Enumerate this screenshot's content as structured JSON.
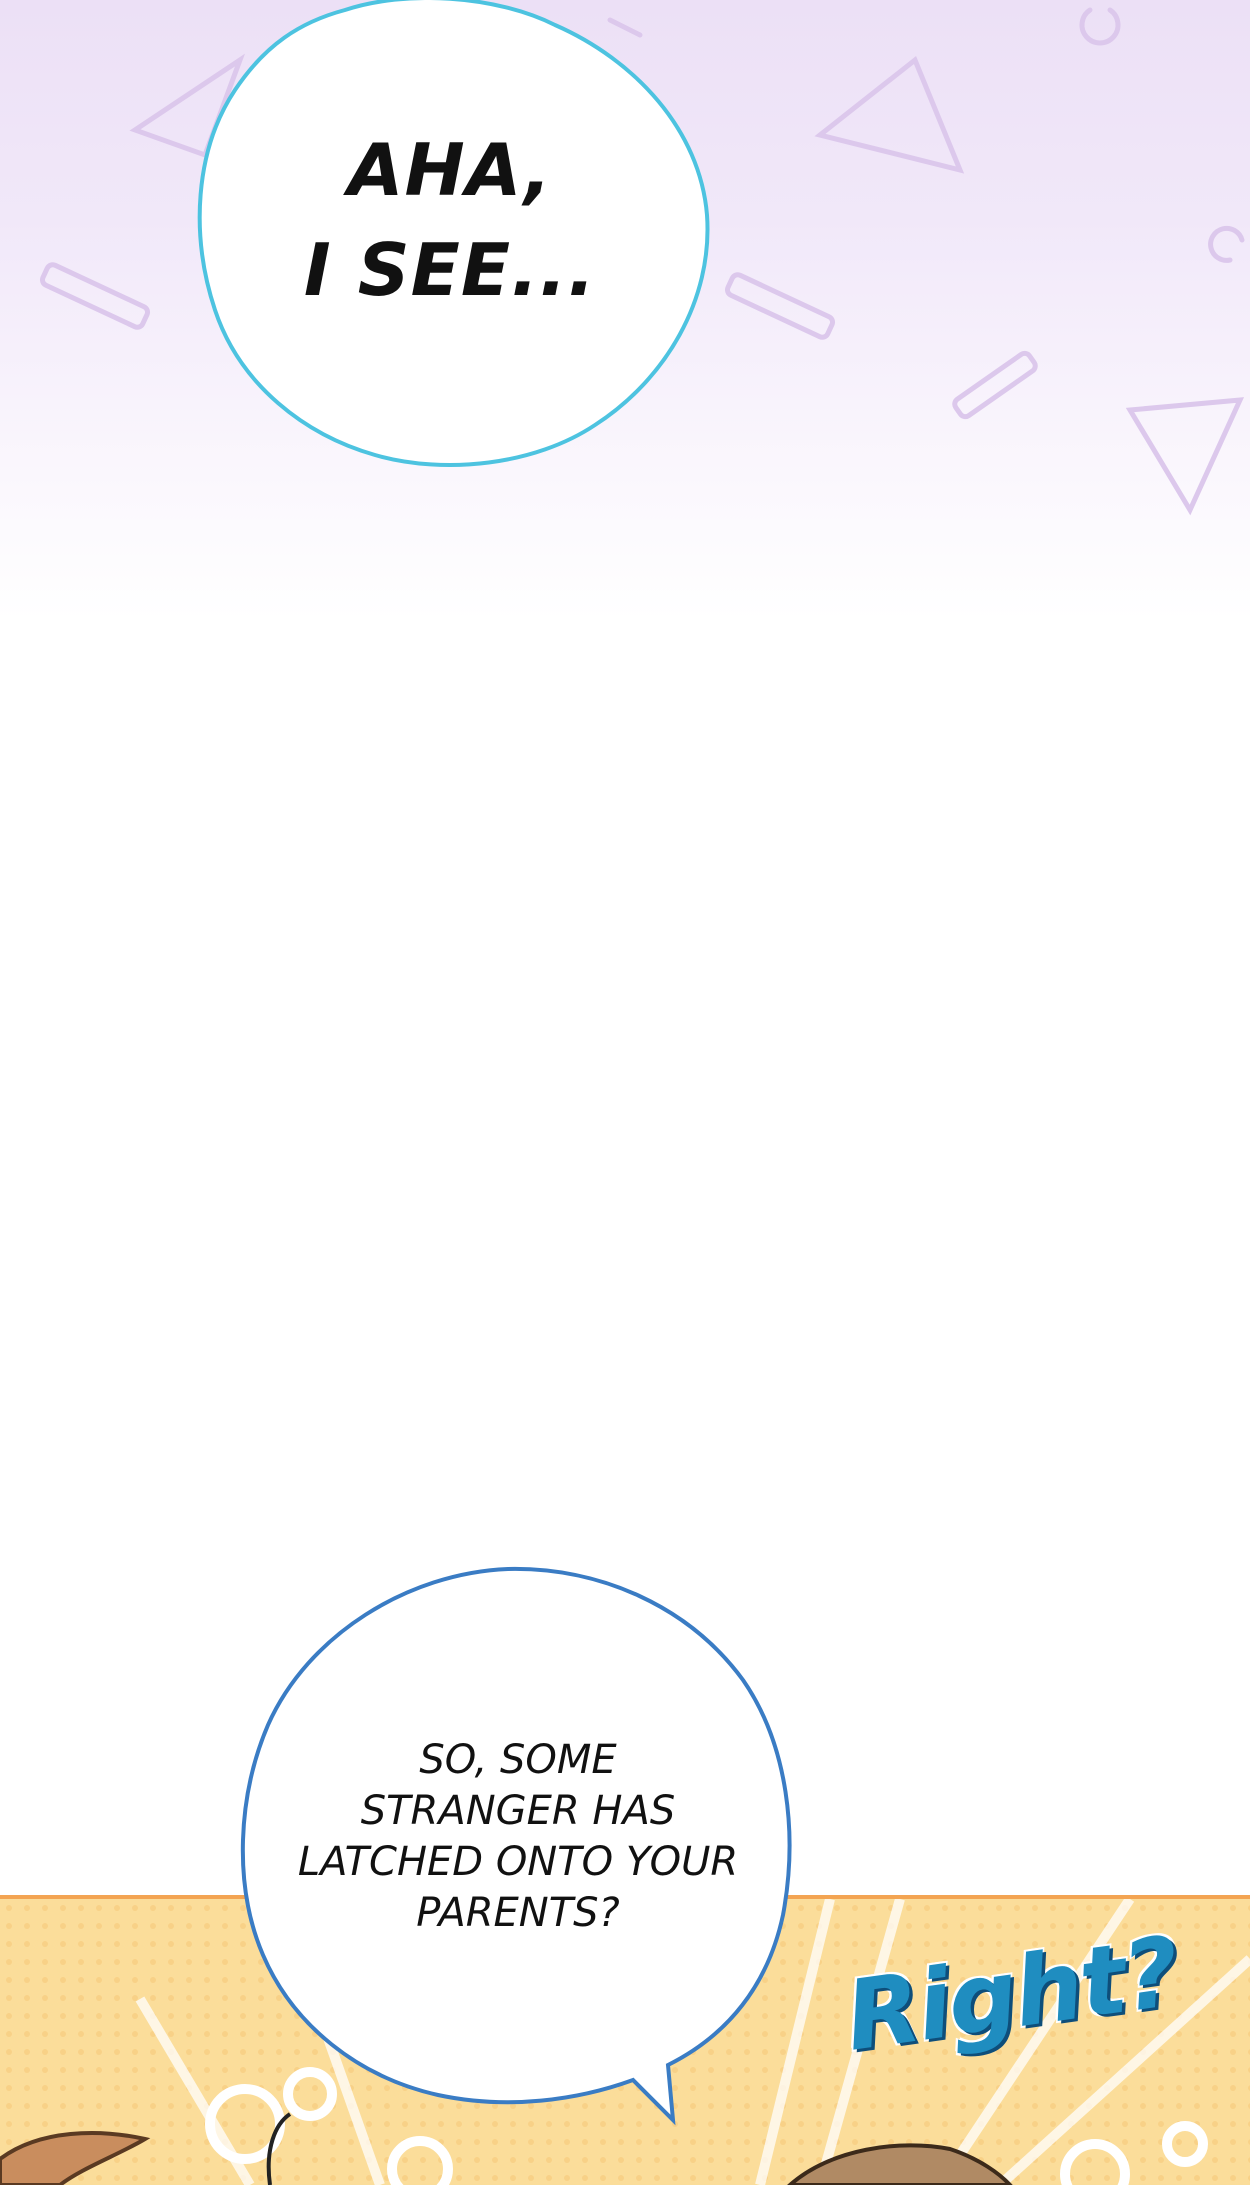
{
  "panel_top": {
    "bubble_text": "AHA,\nI SEE..."
  },
  "panel_bottom": {
    "bubble_text": "SO, SOME\nSTRANGER HAS\nLATCHED ONTO YOUR\nPARENTS?",
    "sfx_text": "Right?"
  },
  "colors": {
    "top_gradient": "#ece0f6",
    "bubble_1_outline": "#4dc3e0",
    "bubble_2_outline": "#3a7cc4",
    "panel_bg": "#fbdd9a",
    "panel_border": "#f3a452",
    "sfx": "#1f8dc0"
  }
}
